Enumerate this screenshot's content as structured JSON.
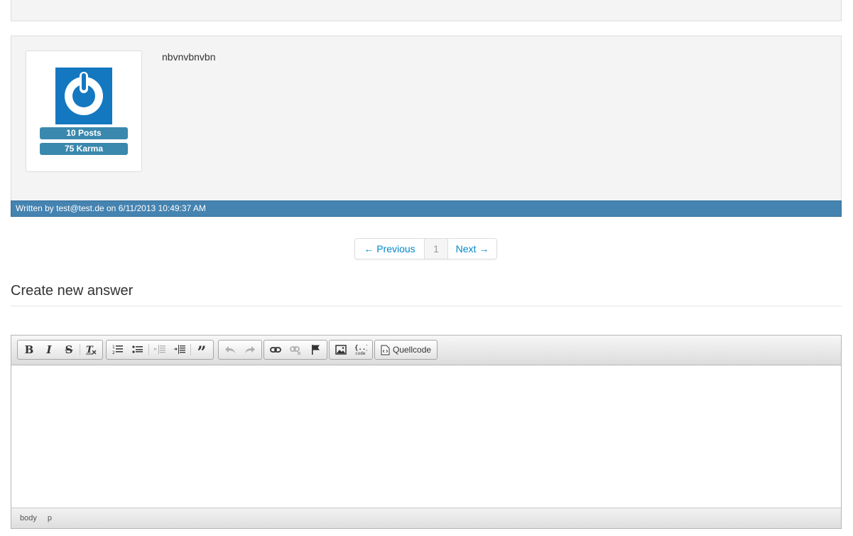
{
  "post": {
    "body_text": "nbvnvbnvbn",
    "posts_badge": "10 Posts",
    "karma_badge": "75 Karma",
    "footer_text": "Written by test@test.de on 6/11/2013 10:49:37 AM",
    "avatar_color": "#1478c0",
    "footer_color": "#4583b0"
  },
  "pagination": {
    "previous": "← Previous",
    "current_page": "1",
    "next": "Next →"
  },
  "answer_section": {
    "title": "Create new answer"
  },
  "editor": {
    "toolbar": {
      "bold_label": "B",
      "italic_label": "I",
      "strike_label": "S",
      "source_label": "Quellcode"
    },
    "statusbar": {
      "path": [
        "body",
        "p"
      ]
    }
  }
}
